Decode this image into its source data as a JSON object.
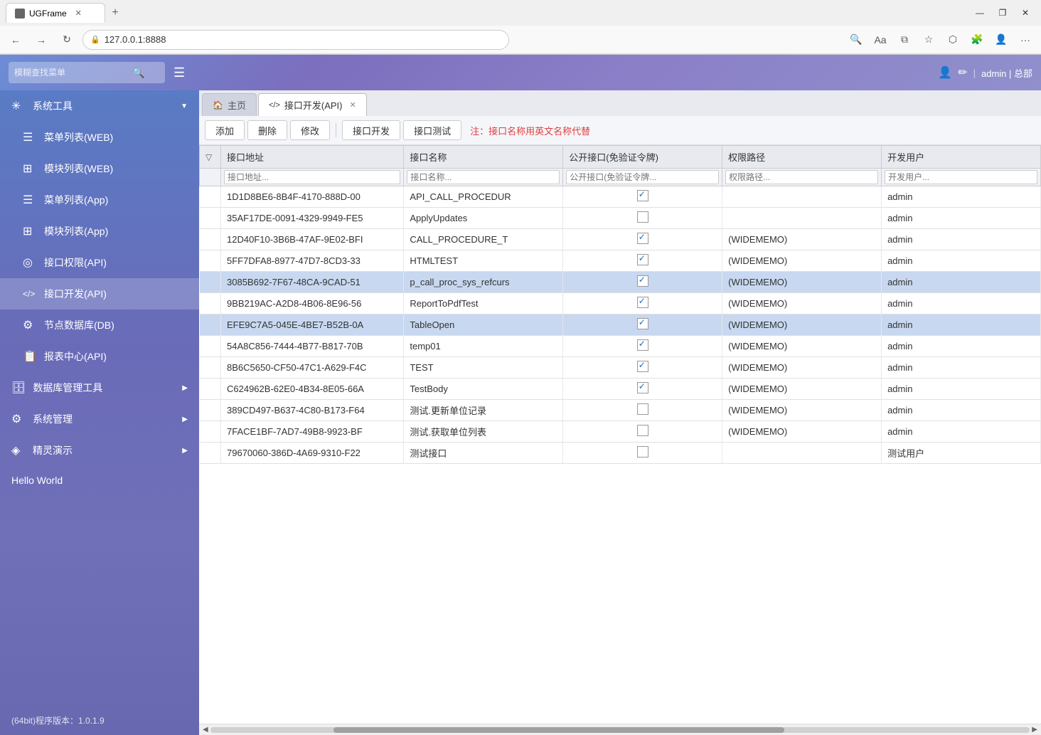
{
  "browser": {
    "tab_label": "UGFrame",
    "address": "127.0.0.1:8888",
    "new_tab_symbol": "+",
    "minimize": "—",
    "restore": "❐",
    "close": "✕"
  },
  "topbar": {
    "search_placeholder": "模糊查找菜单",
    "search_icon": "🔍",
    "hamburger": "☰",
    "user_icon": "👤",
    "edit_icon": "✏",
    "user_label": "admin | 总部"
  },
  "sidebar": {
    "items": [
      {
        "id": "sys-tools",
        "icon": "✳",
        "label": "系统工具",
        "arrow": "▼",
        "has_arrow": true
      },
      {
        "id": "menu-web",
        "icon": "☰",
        "label": "菜单列表(WEB)",
        "has_arrow": false
      },
      {
        "id": "module-web",
        "icon": "⊞",
        "label": "模块列表(WEB)",
        "has_arrow": false
      },
      {
        "id": "menu-app",
        "icon": "☰",
        "label": "菜单列表(App)",
        "has_arrow": false
      },
      {
        "id": "module-app",
        "icon": "⊞",
        "label": "模块列表(App)",
        "has_arrow": false
      },
      {
        "id": "api-auth",
        "icon": "◎",
        "label": "接口权限(API)",
        "has_arrow": false
      },
      {
        "id": "api-dev",
        "icon": "</>",
        "label": "接口开发(API)",
        "has_arrow": false,
        "active": true
      },
      {
        "id": "db-node",
        "icon": "⚙",
        "label": "节点数据库(DB)",
        "has_arrow": false
      },
      {
        "id": "report",
        "icon": "📋",
        "label": "报表中心(API)",
        "has_arrow": false
      },
      {
        "id": "db-mgmt",
        "icon": "🗄",
        "label": "数据库管理工具",
        "arrow": "▶",
        "has_arrow": true
      },
      {
        "id": "sys-mgmt",
        "icon": "⚙",
        "label": "系统管理",
        "arrow": "▶",
        "has_arrow": true
      },
      {
        "id": "sprite",
        "icon": "◈",
        "label": "精灵演示",
        "arrow": "▶",
        "has_arrow": true
      },
      {
        "id": "hello",
        "icon": "",
        "label": "Hello World",
        "has_arrow": false
      }
    ],
    "footer": "(64bit)程序版本：1.0.1.9"
  },
  "tabs": [
    {
      "id": "home",
      "icon": "🏠",
      "label": "主页",
      "active": false,
      "closable": false
    },
    {
      "id": "api-dev",
      "icon": "</>",
      "label": "接口开发(API)",
      "active": true,
      "closable": true
    }
  ],
  "toolbar": {
    "buttons": [
      "添加",
      "删除",
      "修改",
      "接口开发",
      "接口测试"
    ],
    "note": "注：接口名称用英文名称代替"
  },
  "table": {
    "columns": [
      "接口地址",
      "接口名称",
      "公开接口(免验证令牌)",
      "权限路径",
      "开发用户"
    ],
    "filter_placeholders": [
      "接口地址...",
      "接口名称...",
      "公开接口(免验证令牌...",
      "权限路径...",
      "开发用户..."
    ],
    "rows": [
      {
        "id": "1D1D8BE6-8B4F-4170-888D-00",
        "name": "API_CALL_PROCEDUR",
        "public": true,
        "perm": "",
        "user": "admin",
        "selected": false
      },
      {
        "id": "35AF17DE-0091-4329-9949-FE5",
        "name": "ApplyUpdates",
        "public": false,
        "perm": "",
        "user": "admin",
        "selected": false
      },
      {
        "id": "12D40F10-3B6B-47AF-9E02-BFI",
        "name": "CALL_PROCEDURE_T",
        "public": true,
        "perm": "(WIDEMEMO)",
        "user": "admin",
        "selected": false
      },
      {
        "id": "5FF7DFA8-8977-47D7-8CD3-33",
        "name": "HTMLTEST",
        "public": true,
        "perm": "(WIDEMEMO)",
        "user": "admin",
        "selected": false
      },
      {
        "id": "3085B692-7F67-48CA-9CAD-51",
        "name": "p_call_proc_sys_refcurs",
        "public": true,
        "perm": "(WIDEMEMO)",
        "user": "admin",
        "selected": true
      },
      {
        "id": "9BB219AC-A2D8-4B06-8E96-56",
        "name": "ReportToPdfTest",
        "public": true,
        "perm": "(WIDEMEMO)",
        "user": "admin",
        "selected": false
      },
      {
        "id": "EFE9C7A5-045E-4BE7-B52B-0A",
        "name": "TableOpen",
        "public": true,
        "perm": "(WIDEMEMO)",
        "user": "admin",
        "selected": true
      },
      {
        "id": "54A8C856-7444-4B77-B817-70B",
        "name": "temp01",
        "public": true,
        "perm": "(WIDEMEMO)",
        "user": "admin",
        "selected": false
      },
      {
        "id": "8B6C5650-CF50-47C1-A629-F4C",
        "name": "TEST",
        "public": true,
        "perm": "(WIDEMEMO)",
        "user": "admin",
        "selected": false
      },
      {
        "id": "C624962B-62E0-4B34-8E05-66A",
        "name": "TestBody",
        "public": true,
        "perm": "(WIDEMEMO)",
        "user": "admin",
        "selected": false
      },
      {
        "id": "389CD497-B637-4C80-B173-F64",
        "name": "测试.更新单位记录",
        "public": false,
        "perm": "(WIDEMEMO)",
        "user": "admin",
        "selected": false
      },
      {
        "id": "7FACE1BF-7AD7-49B8-9923-BF",
        "name": "测试.获取单位列表",
        "public": false,
        "perm": "(WIDEMEMO)",
        "user": "admin",
        "selected": false
      },
      {
        "id": "79670060-386D-4A69-9310-F22",
        "name": "测试接口",
        "public": false,
        "perm": "",
        "user": "测试用户",
        "selected": false
      }
    ]
  }
}
